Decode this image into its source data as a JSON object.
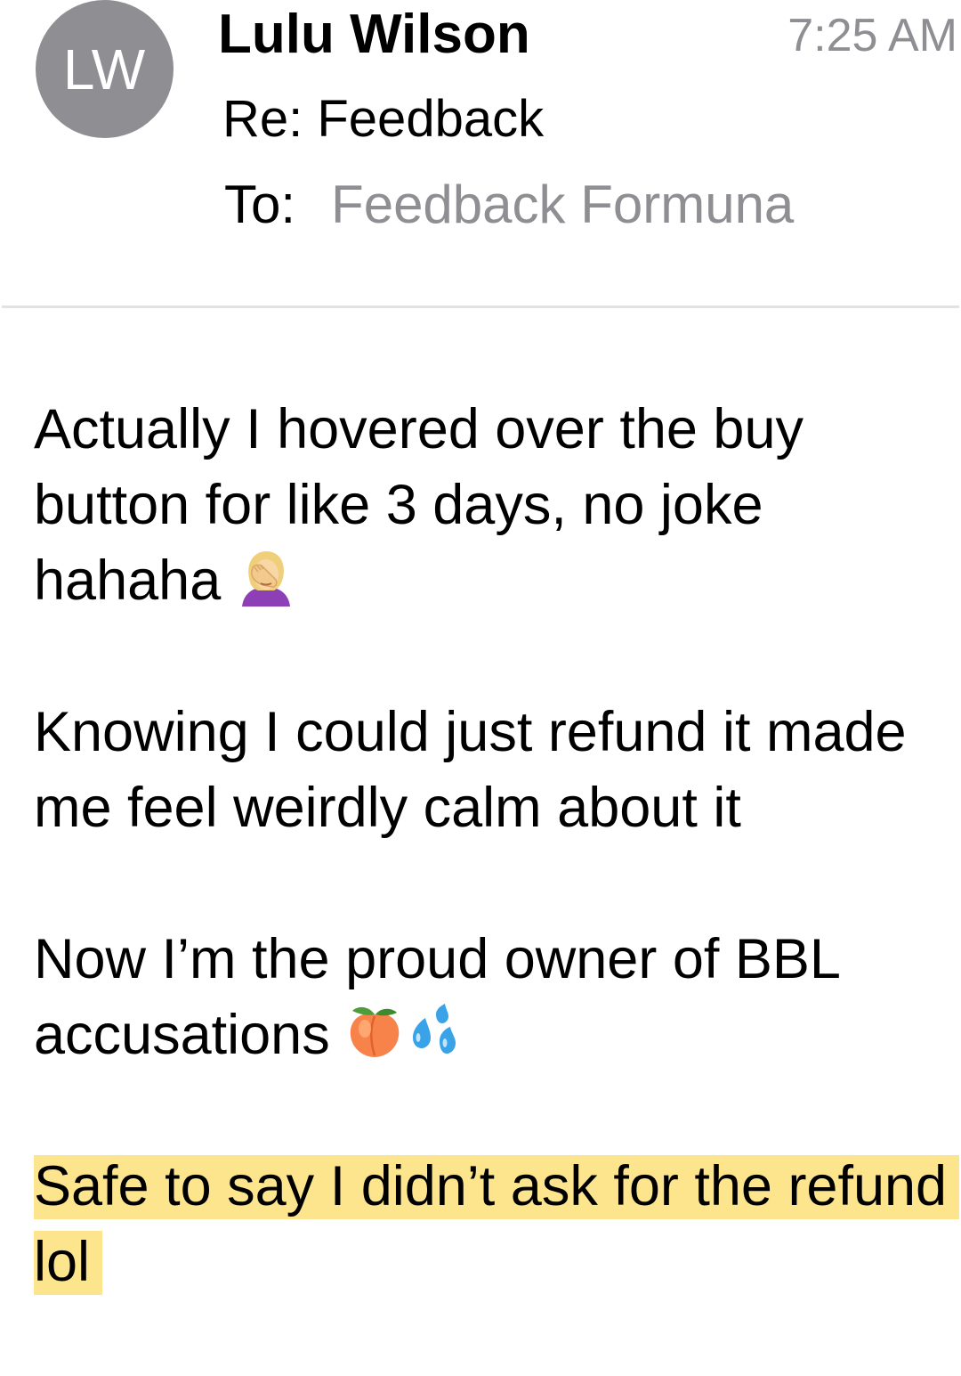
{
  "email": {
    "avatar_initials": "LW",
    "sender": "Lulu Wilson",
    "time": "7:25 AM",
    "subject": "Re: Feedback",
    "to_label": "To:",
    "to_value": "Feedback Formuna"
  },
  "body": {
    "paragraphs": [
      "Actually I hovered over the buy button for like 3 days, no joke hahaha",
      "Knowing I could just refund it made me feel weirdly calm about it",
      "Now I’m the proud owner of BBL accusations",
      "Safe to say I didn’t ask for the refund lol"
    ],
    "emojis": {
      "facepalm": "woman-facepalming-icon",
      "peach": "peach-icon",
      "sweat_droplets": "sweat-droplets-icon"
    }
  },
  "colors": {
    "avatar_bg": "#8e8e93",
    "secondary_text": "#8e8e93",
    "highlight": "#fde58e"
  }
}
